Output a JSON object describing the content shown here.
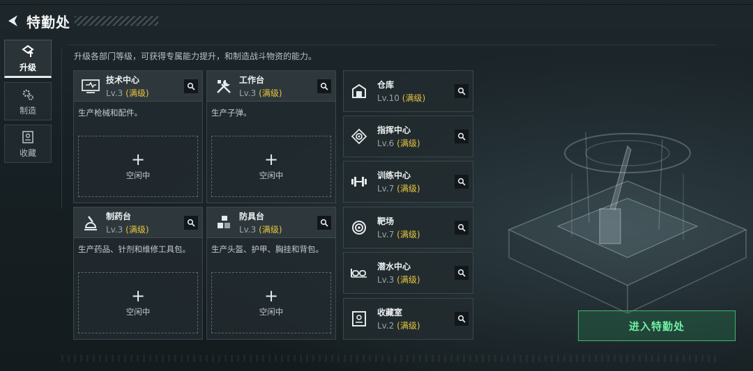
{
  "header": {
    "title": "特勤处"
  },
  "sidebar": {
    "tabs": [
      {
        "label": "升级",
        "icon": "upgrade-icon",
        "active": true
      },
      {
        "label": "制造",
        "icon": "gears-icon",
        "active": false
      },
      {
        "label": "收藏",
        "icon": "collection-icon",
        "active": false
      }
    ]
  },
  "description": "升级各部门等级，可获得专属能力提升，和制造战斗物资的能力。",
  "stations": [
    {
      "name": "技术中心",
      "level": "Lv.3",
      "status": "(满级)",
      "desc": "生产枪械和配件。",
      "slot_plus": "+",
      "slot_label": "空闲中",
      "icon": "tech-center-icon"
    },
    {
      "name": "工作台",
      "level": "Lv.3",
      "status": "(满级)",
      "desc": "生产子弹。",
      "slot_plus": "+",
      "slot_label": "空闲中",
      "icon": "tools-icon"
    },
    {
      "name": "制药台",
      "level": "Lv.3",
      "status": "(满级)",
      "desc": "生产药品、针剂和维修工具包。",
      "slot_plus": "+",
      "slot_label": "空闲中",
      "icon": "pharmacy-icon"
    },
    {
      "name": "防具台",
      "level": "Lv.3",
      "status": "(满级)",
      "desc": "生产头盔、护甲、胸挂和背包。",
      "slot_plus": "+",
      "slot_label": "空闲中",
      "icon": "armor-icon"
    }
  ],
  "facilities": [
    {
      "name": "仓库",
      "level": "Lv.10",
      "status": "(满级)",
      "icon": "warehouse-icon"
    },
    {
      "name": "指挥中心",
      "level": "Lv.6",
      "status": "(满级)",
      "icon": "command-center-icon"
    },
    {
      "name": "训练中心",
      "level": "Lv.7",
      "status": "(满级)",
      "icon": "dumbbell-icon"
    },
    {
      "name": "靶场",
      "level": "Lv.7",
      "status": "(满级)",
      "icon": "target-icon"
    },
    {
      "name": "潜水中心",
      "level": "Lv.3",
      "status": "(满级)",
      "icon": "goggles-icon"
    },
    {
      "name": "收藏室",
      "level": "Lv.2",
      "status": "(满级)",
      "icon": "collection-room-icon"
    }
  ],
  "enter_button": {
    "label": "进入特勤处"
  },
  "colors": {
    "accent_green": "#3fb870",
    "max_level_yellow": "#e8c440"
  }
}
